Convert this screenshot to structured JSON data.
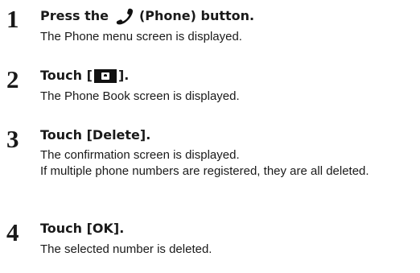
{
  "steps": [
    {
      "number": "1",
      "title_before": "Press the",
      "title_after": "(Phone) button.",
      "icon": "phone-handset-icon",
      "desc": [
        "The Phone menu screen is displayed."
      ]
    },
    {
      "number": "2",
      "title_before": "Touch [",
      "title_after": "].",
      "icon": "phonebook-icon",
      "desc": [
        "The Phone Book screen is displayed."
      ]
    },
    {
      "number": "3",
      "title": "Touch [Delete].",
      "desc": [
        "The confirmation screen is displayed.",
        "If multiple phone numbers are registered, they are all deleted."
      ]
    },
    {
      "number": "4",
      "title": "Touch [OK].",
      "desc": [
        "The selected number is deleted."
      ]
    }
  ]
}
